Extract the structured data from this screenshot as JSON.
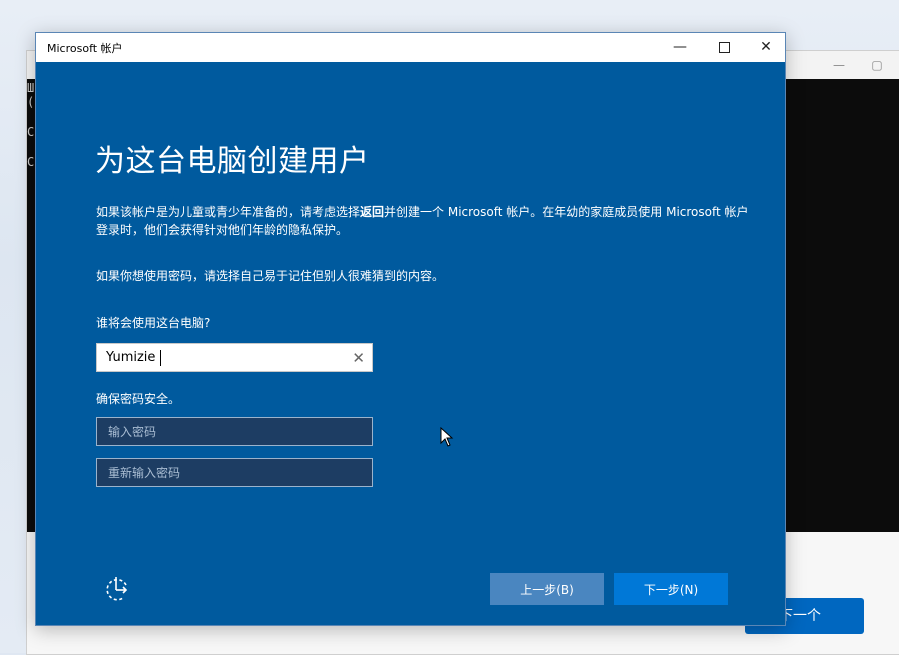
{
  "background_window": {
    "console_lines": [
      "Ш",
      "(",
      "C",
      "C"
    ],
    "next_button_label": "下一个"
  },
  "dialog": {
    "title": "Microsoft 帐户",
    "heading": "为这台电脑创建用户",
    "paragraph1_part1": "如果该帐户是为儿童或青少年准备的，请考虑选择",
    "paragraph1_bold": "返回",
    "paragraph1_part2": "并创建一个 Microsoft 帐户。在年幼的家庭成员使用 Microsoft 帐户登录时，他们会获得针对他们年龄的隐私保护。",
    "paragraph2": "如果你想使用密码，请选择自己易于记住但别人很难猜到的内容。",
    "user_label": "谁将会使用这台电脑?",
    "user_value": "Yumizie",
    "password_label": "确保密码安全。",
    "password_placeholder": "输入密码",
    "password_confirm_placeholder": "重新输入密码",
    "back_button": "上一步(B)",
    "next_button": "下一步(N)"
  },
  "colors": {
    "dialog_background": "#005a9e",
    "primary_button": "#0078d7",
    "secondary_button": "#4a86c0"
  },
  "icons": {
    "window_controls": [
      "minimize-icon",
      "maximize-icon",
      "close-icon"
    ],
    "field_clear": "clear-icon",
    "accessibility": "ease-of-access-icon",
    "pointer": "mouse-cursor-icon"
  }
}
